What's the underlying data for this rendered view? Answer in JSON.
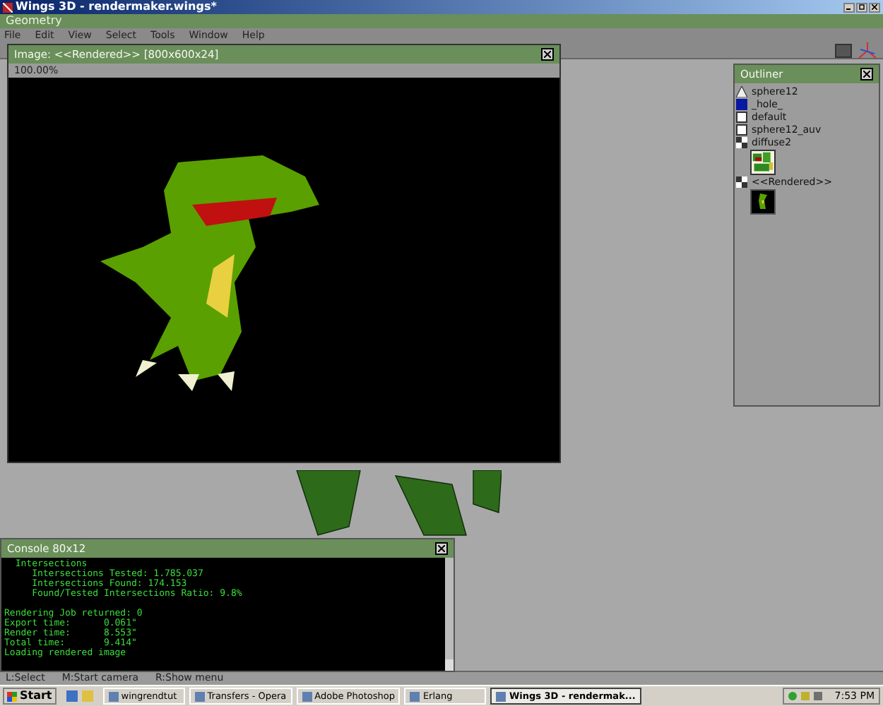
{
  "window": {
    "title": "Wings 3D - rendermaker.wings*"
  },
  "geometry_bar": {
    "title": "Geometry"
  },
  "menu": [
    "File",
    "Edit",
    "View",
    "Select",
    "Tools",
    "Window",
    "Help"
  ],
  "image_window": {
    "title": "Image: <<Rendered>> [800x600x24]",
    "zoom": "100.00%"
  },
  "outliner": {
    "title": "Outliner",
    "items": [
      {
        "label": "sphere12",
        "kind": "object"
      },
      {
        "label": "_hole_",
        "kind": "material"
      },
      {
        "label": "default",
        "kind": "material-white"
      },
      {
        "label": "sphere12_auv",
        "kind": "material-white"
      },
      {
        "label": "diffuse2",
        "kind": "image-texture"
      },
      {
        "label": "<<Rendered>>",
        "kind": "image-render"
      }
    ]
  },
  "console": {
    "title": "Console 80x12",
    "blocks": [
      [
        "  Intersections",
        "     Intersections Tested: 1.785.037",
        "     Intersections Found: 174.153",
        "     Found/Tested Intersections Ratio: 9.8%"
      ],
      [
        "Rendering Job returned: 0",
        "Export time:      0.061\"",
        "Render time:      8.553\"",
        "Total time:       9.414\"",
        "Loading rendered image"
      ]
    ]
  },
  "status_bar": [
    "L:Select",
    "M:Start camera",
    "R:Show menu"
  ],
  "taskbar": {
    "start": "Start",
    "tasks": [
      {
        "label": "wingrendtut",
        "selected": false
      },
      {
        "label": "Transfers - Opera",
        "selected": false
      },
      {
        "label": "Adobe Photoshop",
        "selected": false
      },
      {
        "label": "Erlang",
        "selected": false
      },
      {
        "label": "Wings 3D - rendermak...",
        "selected": true
      }
    ],
    "clock": "7:53 PM"
  }
}
